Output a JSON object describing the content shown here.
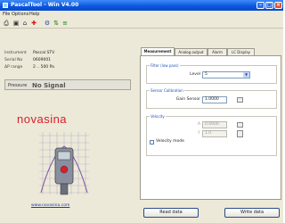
{
  "window": {
    "title": "PascalTool - Win V4.00"
  },
  "menu": {
    "file": "File",
    "options": "Options",
    "help": "Help"
  },
  "instrument": {
    "rows": [
      {
        "label": "Instrument",
        "value": "Pascal STV"
      },
      {
        "label": "Serial No",
        "value": "0609001"
      },
      {
        "label": "ΔP range",
        "value": "2 .. 500 Pa"
      }
    ],
    "pressure_label": "Pressure",
    "pressure_value": "No Signal",
    "logo": "novasina",
    "website": "www.novasina.com"
  },
  "tabs": [
    "Measurement",
    "Analog output",
    "Alarm",
    "LC Display"
  ],
  "filter": {
    "group": "Filter (low pass)",
    "level_label": "Level",
    "level_value": "5"
  },
  "sensor": {
    "group": "Sensor Calibration",
    "gain_label": "Gain Sensor",
    "gain_value": "1.0000"
  },
  "velocity": {
    "group": "Velocity",
    "a_label": "A",
    "a_value": "0.0000",
    "f_label": "F",
    "f_value": "1.0",
    "mode_label": "Velocity mode"
  },
  "buttons": {
    "read": "Read data",
    "write": "Write data"
  },
  "colors": {
    "titlebar": "#0a55e0",
    "logo": "#d81f2a",
    "link": "#1a3bb0"
  }
}
